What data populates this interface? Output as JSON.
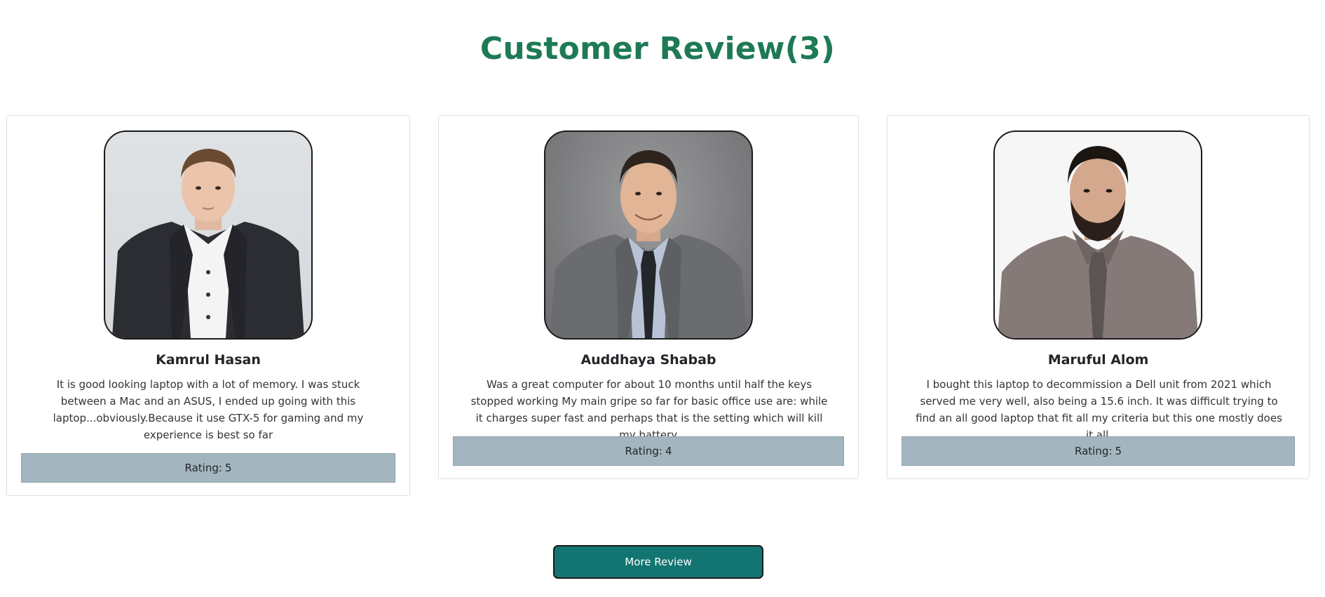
{
  "section": {
    "title": "Customer Review(3)"
  },
  "reviews": [
    {
      "name": "Kamrul Hasan",
      "text": "It is good looking laptop with a lot of memory. I was stuck between a Mac and an ASUS, I ended up going with this laptop...obviously.Because it use GTX-5 for gaming and my experience is best so far",
      "rating_label": "Rating:",
      "rating": "5"
    },
    {
      "name": "Auddhaya Shabab",
      "text": "Was a great computer for about 10 months until half the keys stopped working My main gripe so far for basic office use are: while it charges super fast and perhaps that is the setting which will kill my battery.",
      "rating_label": "Rating:",
      "rating": "4"
    },
    {
      "name": "Maruful Alom",
      "text": "I bought this laptop to decommission a Dell unit from 2021 which served me very well, also being a 15.6 inch. It was difficult trying to find an all good laptop that fit all my criteria but this one mostly does it all.",
      "rating_label": "Rating:",
      "rating": "5"
    }
  ],
  "more_button": {
    "label": "More Review"
  },
  "colors": {
    "title": "#1e7a55",
    "rating_bar": "#a3b6bf",
    "button": "#137571"
  }
}
